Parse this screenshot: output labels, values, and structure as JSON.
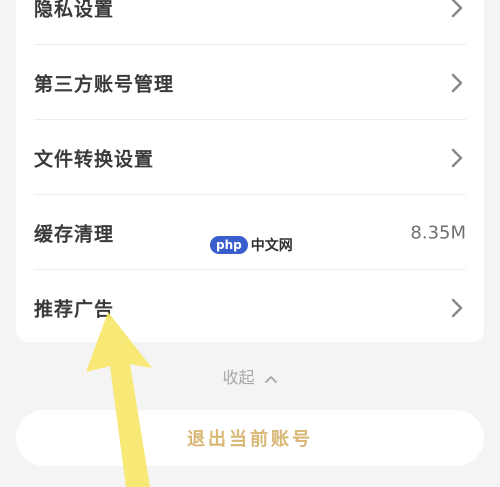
{
  "settings": {
    "items": [
      {
        "label": "隐私设置",
        "chevron": "chevron-right-icon"
      },
      {
        "label": "第三方账号管理",
        "chevron": "chevron-right-icon"
      },
      {
        "label": "文件转换设置",
        "chevron": "chevron-right-icon"
      },
      {
        "label": "缓存清理",
        "value": "8.35M"
      },
      {
        "label": "推荐广告",
        "chevron": "chevron-right-icon"
      }
    ]
  },
  "collapse": {
    "label": "收起",
    "icon": "chevron-up-icon"
  },
  "logout": {
    "label": "退出当前账号"
  },
  "watermark": {
    "pill": "php",
    "text": "中文网"
  },
  "colors": {
    "accent_gold": "#d9b775",
    "arrow_yellow": "#f7e66a",
    "watermark_blue": "#3a5fcd"
  }
}
